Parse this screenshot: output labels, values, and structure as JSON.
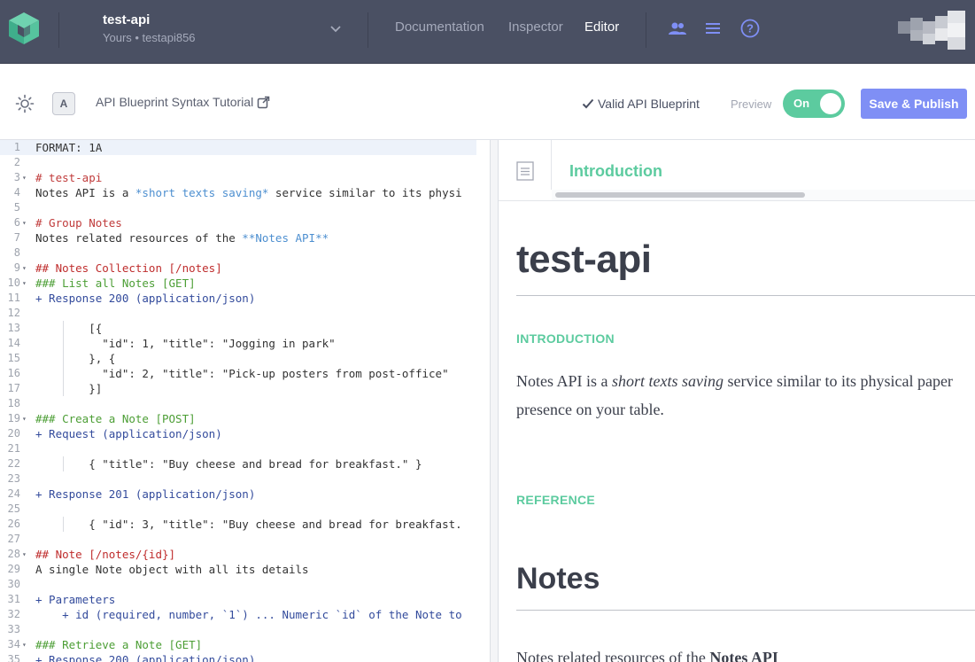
{
  "header": {
    "project_name": "test-api",
    "project_owner": "Yours • testapi856",
    "nav": {
      "documentation": "Documentation",
      "inspector": "Inspector",
      "editor": "Editor"
    },
    "icons": [
      "team-icon",
      "list-icon",
      "help-icon"
    ],
    "colors": {
      "bar": "#4a5063",
      "logo": "#5ccb9f"
    }
  },
  "toolbar": {
    "keymap_label": "A",
    "tutorial_link": "API Blueprint Syntax Tutorial",
    "valid_status": "Valid API Blueprint",
    "preview_label": "Preview",
    "preview_toggle": "On",
    "save_button": "Save & Publish",
    "colors": {
      "toggle": "#5ccb9f",
      "save": "#7f8ff5"
    }
  },
  "editor": {
    "lines": [
      {
        "n": "1",
        "fold": false,
        "tokens": [
          {
            "c": "plain",
            "t": "FORMAT: 1A"
          }
        ]
      },
      {
        "n": "2",
        "fold": false,
        "tokens": []
      },
      {
        "n": "3",
        "fold": true,
        "tokens": [
          {
            "c": "h1",
            "t": "# test-api"
          }
        ]
      },
      {
        "n": "4",
        "fold": false,
        "tokens": [
          {
            "c": "plain",
            "t": "Notes API is a "
          },
          {
            "c": "em",
            "t": "*short texts saving*"
          },
          {
            "c": "plain",
            "t": " service similar to its physi"
          }
        ]
      },
      {
        "n": "5",
        "fold": false,
        "tokens": []
      },
      {
        "n": "6",
        "fold": true,
        "tokens": [
          {
            "c": "h1",
            "t": "# Group Notes"
          }
        ]
      },
      {
        "n": "7",
        "fold": false,
        "tokens": [
          {
            "c": "plain",
            "t": "Notes related resources of the "
          },
          {
            "c": "em",
            "t": "**Notes API**"
          }
        ]
      },
      {
        "n": "8",
        "fold": false,
        "tokens": []
      },
      {
        "n": "9",
        "fold": true,
        "tokens": [
          {
            "c": "h2",
            "t": "## Notes Collection [/notes]"
          }
        ]
      },
      {
        "n": "10",
        "fold": true,
        "tokens": [
          {
            "c": "h3",
            "t": "### List all Notes [GET]"
          }
        ]
      },
      {
        "n": "11",
        "fold": false,
        "tokens": [
          {
            "c": "plus",
            "t": "+ Response 200 (application/json)"
          }
        ]
      },
      {
        "n": "12",
        "fold": false,
        "tokens": []
      },
      {
        "n": "13",
        "fold": false,
        "tokens": [
          {
            "c": "plain",
            "t": "        [{"
          }
        ]
      },
      {
        "n": "14",
        "fold": false,
        "tokens": [
          {
            "c": "plain",
            "t": "          \"id\": 1, \"title\": \"Jogging in park\""
          }
        ]
      },
      {
        "n": "15",
        "fold": false,
        "tokens": [
          {
            "c": "plain",
            "t": "        }, {"
          }
        ]
      },
      {
        "n": "16",
        "fold": false,
        "tokens": [
          {
            "c": "plain",
            "t": "          \"id\": 2, \"title\": \"Pick-up posters from post-office\""
          }
        ]
      },
      {
        "n": "17",
        "fold": false,
        "tokens": [
          {
            "c": "plain",
            "t": "        }]"
          }
        ]
      },
      {
        "n": "18",
        "fold": false,
        "tokens": []
      },
      {
        "n": "19",
        "fold": true,
        "tokens": [
          {
            "c": "h3",
            "t": "### Create a Note [POST]"
          }
        ]
      },
      {
        "n": "20",
        "fold": false,
        "tokens": [
          {
            "c": "plus",
            "t": "+ Request (application/json)"
          }
        ]
      },
      {
        "n": "21",
        "fold": false,
        "tokens": []
      },
      {
        "n": "22",
        "fold": false,
        "tokens": [
          {
            "c": "plain",
            "t": "        { \"title\": \"Buy cheese and bread for breakfast.\" }"
          }
        ]
      },
      {
        "n": "23",
        "fold": false,
        "tokens": []
      },
      {
        "n": "24",
        "fold": false,
        "tokens": [
          {
            "c": "plus",
            "t": "+ Response 201 (application/json)"
          }
        ]
      },
      {
        "n": "25",
        "fold": false,
        "tokens": []
      },
      {
        "n": "26",
        "fold": false,
        "tokens": [
          {
            "c": "plain",
            "t": "        { \"id\": 3, \"title\": \"Buy cheese and bread for breakfast."
          }
        ]
      },
      {
        "n": "27",
        "fold": false,
        "tokens": []
      },
      {
        "n": "28",
        "fold": true,
        "tokens": [
          {
            "c": "h2",
            "t": "## Note [/notes/{id}]"
          }
        ]
      },
      {
        "n": "29",
        "fold": false,
        "tokens": [
          {
            "c": "plain",
            "t": "A single Note object with all its details"
          }
        ]
      },
      {
        "n": "30",
        "fold": false,
        "tokens": []
      },
      {
        "n": "31",
        "fold": false,
        "tokens": [
          {
            "c": "plus",
            "t": "+ Parameters"
          }
        ]
      },
      {
        "n": "32",
        "fold": false,
        "tokens": [
          {
            "c": "plus",
            "t": "    + id (required, number, `1`) ... Numeric `id` of the Note to"
          }
        ]
      },
      {
        "n": "33",
        "fold": false,
        "tokens": []
      },
      {
        "n": "34",
        "fold": true,
        "tokens": [
          {
            "c": "h3",
            "t": "### Retrieve a Note [GET]"
          }
        ]
      },
      {
        "n": "35",
        "fold": false,
        "tokens": [
          {
            "c": "plus",
            "t": "+ Response 200 (application/json)"
          }
        ]
      }
    ]
  },
  "preview": {
    "toc_title": "Introduction",
    "api_title": "test-api",
    "intro_heading": "INTRODUCTION",
    "intro_para_1_pre": "Notes API is a ",
    "intro_para_1_em": "short texts saving",
    "intro_para_1_post": " service similar to its physical paper",
    "intro_para_2": "presence on your table.",
    "reference_heading": "REFERENCE",
    "group_title": "Notes",
    "group_para_pre": "Notes related resources of the ",
    "group_para_bold": "Notes API"
  }
}
